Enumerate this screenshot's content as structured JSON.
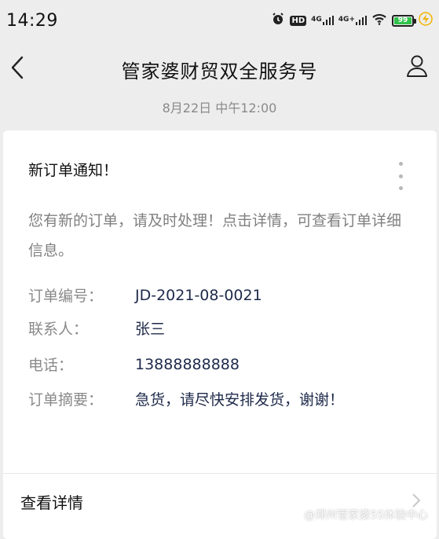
{
  "status_bar": {
    "time": "14:29",
    "icons": [
      "alarm-icon",
      "hd-icon",
      "signal-4g-icon",
      "signal-4g-plus-icon",
      "wifi-icon",
      "battery-icon",
      "charging-icon"
    ],
    "hd_text": "HD",
    "net1": "4G",
    "net2": "4G+",
    "battery_level": "99"
  },
  "nav": {
    "title": "管家婆财贸双全服务号"
  },
  "message": {
    "time": "8月22日 中午12:00",
    "title": "新订单通知！",
    "description": "您有新的订单，请及时处理！点击详情，可查看订单详细信息。",
    "fields": [
      {
        "label": "订单编号：",
        "value": "JD-2021-08-0021"
      },
      {
        "label": "联系人：",
        "value": "张三"
      },
      {
        "label": "电话：",
        "value": "13888888888"
      },
      {
        "label": "订单摘要：",
        "value": "急货，请尽快安排发货，谢谢！"
      }
    ],
    "detail_label": "查看详情"
  },
  "watermark": {
    "text": "@郑州管家婆5S体验中心"
  },
  "colors": {
    "background": "#ededed",
    "card": "#ffffff",
    "value_text": "#1e2a4a",
    "label_text": "#8a8a8a",
    "battery": "#31c24a"
  }
}
